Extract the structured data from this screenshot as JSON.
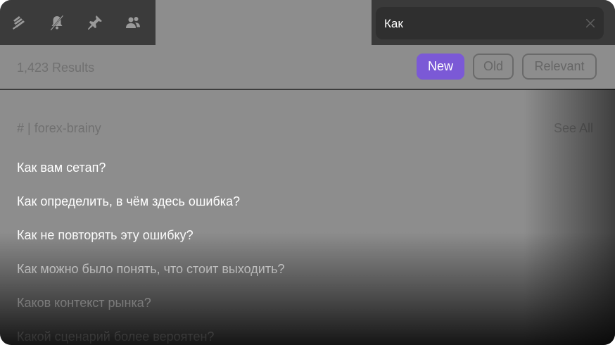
{
  "toolbar": {
    "icons": [
      "threads-icon",
      "mute-bell-icon",
      "pin-icon",
      "members-icon"
    ]
  },
  "search": {
    "value": "Как",
    "clear_icon": "close-icon"
  },
  "filters": {
    "results_count": "1,423 Results",
    "new_label": "New",
    "old_label": "Old",
    "relevant_label": "Relevant",
    "active": "New",
    "accent_color": "#7b59d6"
  },
  "section": {
    "title": "# | forex-brainy",
    "see_all_label": "See All"
  },
  "results": [
    "Как вам сетап?",
    "Как определить, в чём здесь ошибка?",
    "Как не повторять эту ошибку?",
    "Как можно было понять, что стоит выходить?",
    "Каков контекст рынка?",
    "Какой сценарий более вероятен?"
  ]
}
